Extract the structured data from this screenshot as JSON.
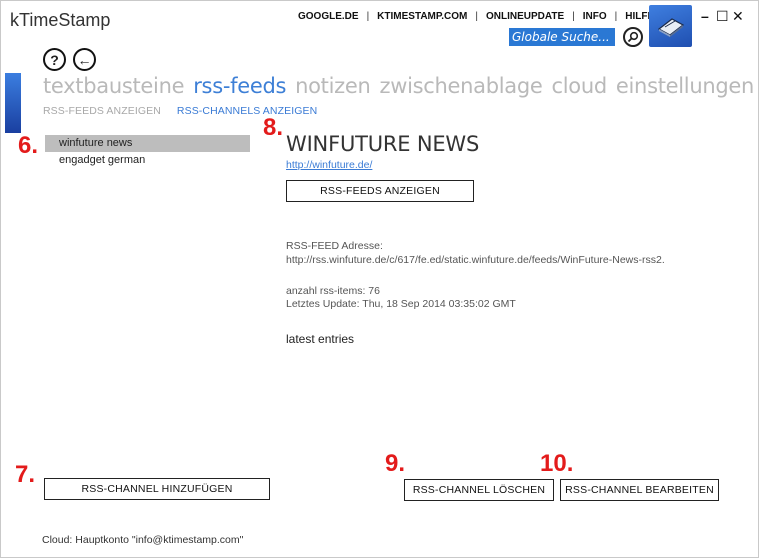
{
  "app": {
    "title": "kTimeStamp"
  },
  "topnav": {
    "links": [
      "GOOGLE.DE",
      "KTIMESTAMP.COM",
      "ONLINEUPDATE",
      "INFO",
      "HILFE"
    ],
    "separator": "|"
  },
  "search": {
    "placeholder": "Globale Suche..."
  },
  "window_controls": {
    "minimize": "–",
    "maximize": "☐",
    "close": "✕"
  },
  "toolbar": {
    "help_glyph": "?",
    "back_glyph": "←"
  },
  "main_tabs": [
    "textbausteine",
    "rss-feeds",
    "notizen",
    "zwischenablage",
    "cloud",
    "einstellungen"
  ],
  "main_tab_active_index": 1,
  "sub_tabs": [
    "RSS-FEEDS ANZEIGEN",
    "RSS-CHANNELS ANZEIGEN"
  ],
  "sub_tab_active_index": 1,
  "channels": [
    "winfuture news",
    "engadget german"
  ],
  "channel_selected_index": 0,
  "steps": {
    "s6": "6.",
    "s7": "7.",
    "s8": "8.",
    "s9": "9.",
    "s10": "10."
  },
  "detail": {
    "title": "WINFUTURE NEWS",
    "url": "http://winfuture.de/",
    "show_feeds_label": "RSS-FEEDS ANZEIGEN",
    "feed_address_label": "RSS-FEED Adresse:",
    "feed_address_value": "http://rss.winfuture.de/c/617/fe.ed/static.winfuture.de/feeds/WinFuture-News-rss2.",
    "items_count_line": "anzahl rss-items: 76",
    "last_update_line": "Letztes Update: Thu, 18 Sep 2014 03:35:02 GMT",
    "latest_entries": "latest entries"
  },
  "buttons": {
    "add_channel": "RSS-CHANNEL HINZUFÜGEN",
    "delete_channel": "RSS-CHANNEL LÖSCHEN",
    "edit_channel": "RSS-CHANNEL BEARBEITEN"
  },
  "footer": {
    "cloud_status": "Cloud: Hauptkonto \"info@ktimestamp.com\""
  },
  "colors": {
    "accent": "#3d7fd6",
    "search_bg": "#2a78d4",
    "step_red": "#e31b1b",
    "selected_row": "#bdbdbd"
  }
}
